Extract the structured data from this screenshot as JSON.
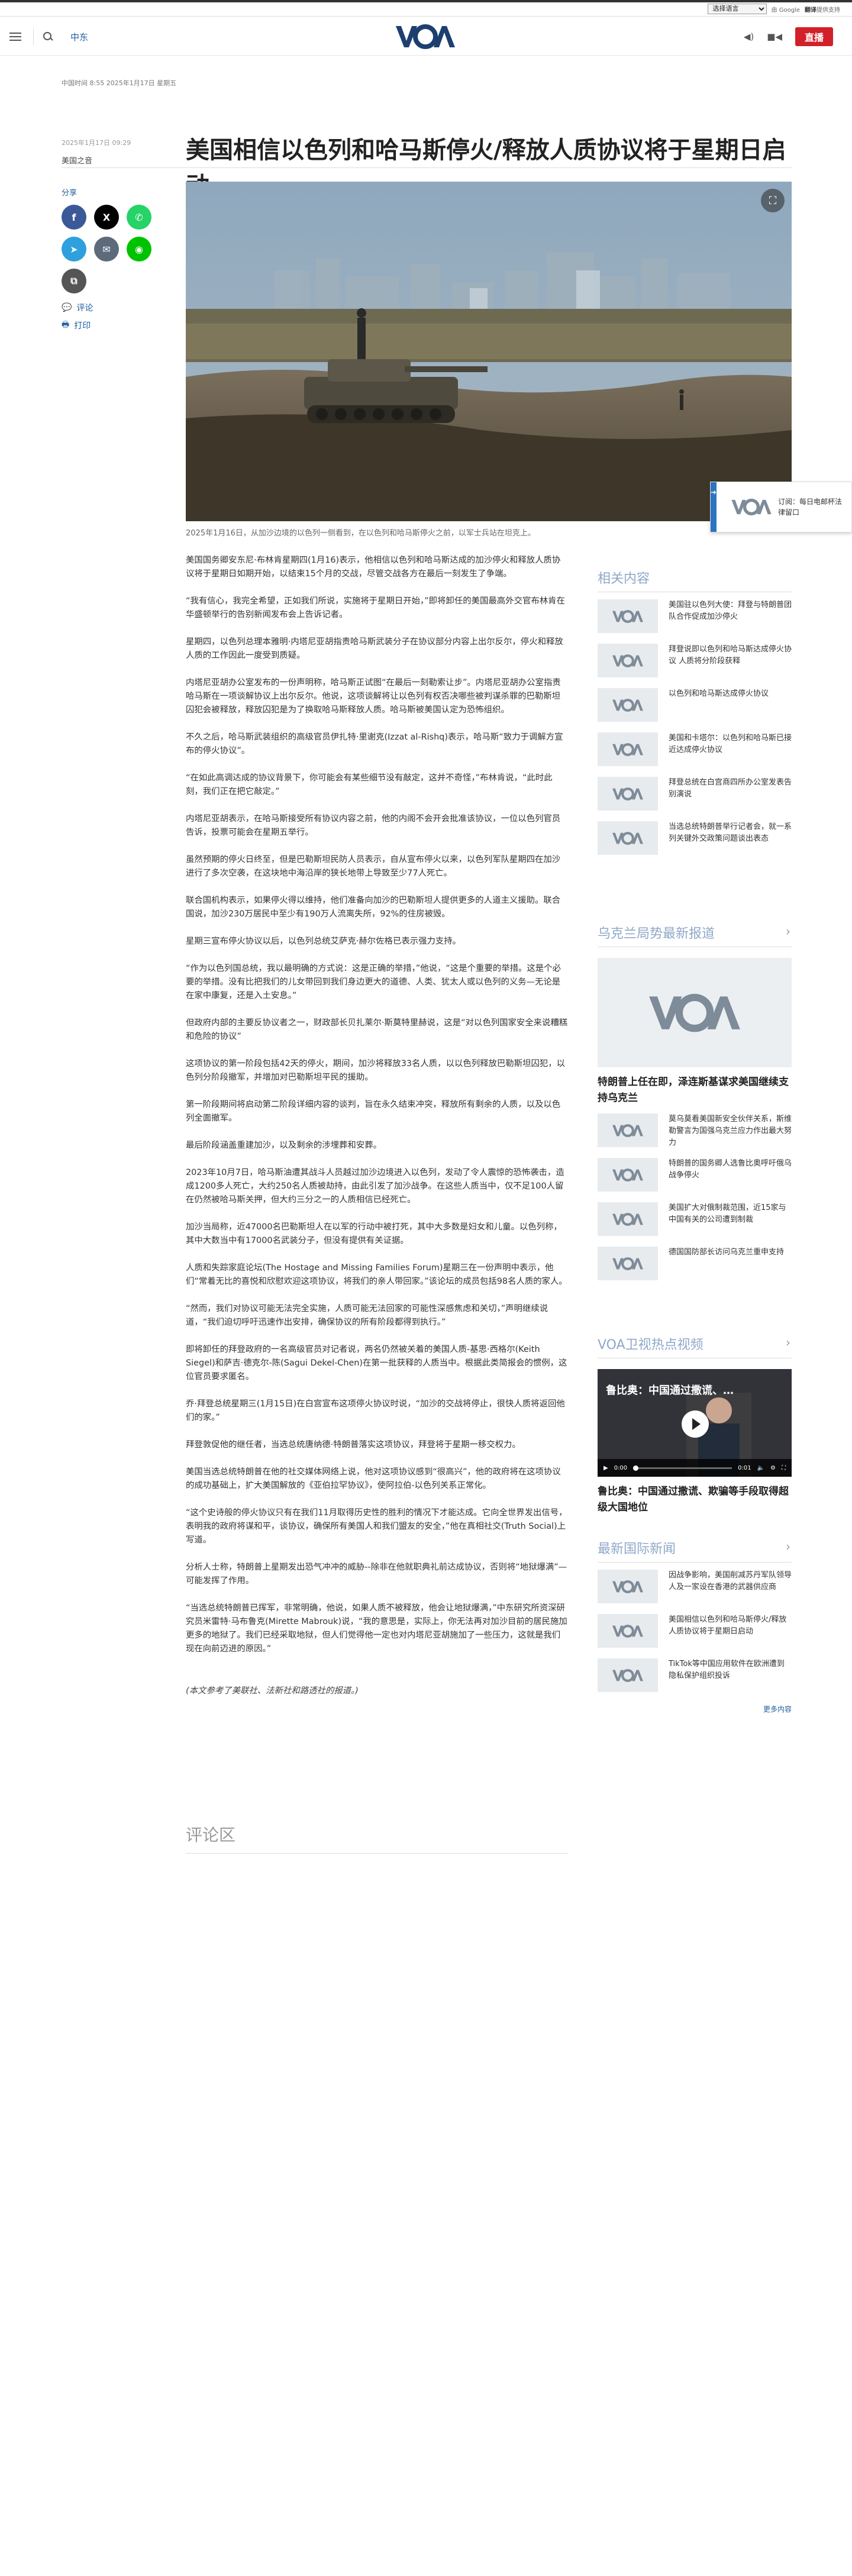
{
  "translate_bar": {
    "select_label": "选择语言",
    "powered_by": "由 Google",
    "translate_label": "翻译",
    "power_suffix": "提供支持"
  },
  "header": {
    "section": "中东",
    "logo_text": "VOA",
    "live_label": "直播"
  },
  "article": {
    "published": "中国时间 8:55 2025年1月17日 星期五",
    "updated": "2025年1月17日 09:29",
    "author": "美国之音",
    "title": "美国相信以色列和哈马斯停火/释放人质协议将于星期日启动",
    "caption": "2025年1月16日，从加沙边境的以色列一侧看到，在以色列和哈马斯停火之前，以军士兵站在坦克上。",
    "paragraphs": [
      "美国国务卿安东尼·布林肯星期四(1月16)表示，他相信以色列和哈马斯达成的加沙停火和释放人质协议将于星期日如期开始，以结束15个月的交战，尽管交战各方在最后一刻发生了争端。",
      "“我有信心，我完全希望，正如我们所说，实施将于星期日开始，”即将卸任的美国最高外交官布林肯在华盛顿举行的告别新闻发布会上告诉记者。",
      "星期四，以色列总理本雅明·内塔尼亚胡指责哈马斯武装分子在协议部分内容上出尔反尔，停火和释放人质的工作因此一度受到质疑。",
      "内塔尼亚胡办公室发布的一份声明称，哈马斯正试图“在最后一刻勒索让步”。内塔尼亚胡办公室指责哈马斯在一项谈解协议上出尔反尔。他说，这项谈解将让以色列有权否决哪些被判谋杀罪的巴勒斯坦囚犯会被释放，释放囚犯是为了换取哈马斯释放人质。哈马斯被美国认定为恐怖组织。",
      "不久之后，哈马斯武装组织的高级官员伊扎特·里谢克(Izzat al-Rishq)表示，哈马斯“致力于调解方宣布的停火协议”。",
      "“在如此高调达成的协议背景下，你可能会有某些细节没有敲定，这并不奇怪，”布林肯说，“此时此刻，我们正在把它敲定。”",
      "内塔尼亚胡表示，在哈马斯接受所有协议内容之前，他的内阁不会开会批准该协议，一位以色列官员告诉，投票可能会在星期五举行。",
      "虽然预期的停火日终至，但是巴勒斯坦民防人员表示，自从宣布停火以来，以色列军队星期四在加沙进行了多次空袭，在这块地中海沿岸的狭长地带上导致至少77人死亡。",
      "联合国机构表示，如果停火得以维持，他们准备向加沙的巴勒斯坦人提供更多的人道主义援助。联合国说，加沙230万居民中至少有190万人流离失所，92%的住房被毁。",
      "星期三宣布停火协议以后，以色列总统艾萨克·赫尔佐格已表示强力支持。",
      "“作为以色列国总统，我以最明确的方式说：这是正确的举措，”他说，“这是个重要的举措。这是个必要的举措。没有比把我们的儿女带回到我们身边更大的道德、人类、犹太人或以色列的义务—无论是在家中康复，还是入土安息。”",
      "但政府内部的主要反协议者之一，财政部长贝扎莱尔·斯莫特里赫说，这是“对以色列国家安全来说糟糕和危险的协议”",
      "这项协议的第一阶段包括42天的停火，期间，加沙将释放33名人质，以以色列释放巴勒斯坦囚犯，以色列分阶段撤军，并增加对巴勒斯坦平民的援助。",
      "第一阶段期间将启动第二阶段详细内容的谈判，旨在永久结束冲突，释放所有剩余的人质，以及以色列全面撤军。",
      "最后阶段涵盖重建加沙，以及剩余的涉埋葬和安葬。",
      "2023年10月7日，哈马斯油遭其战斗人员越过加沙边境进入以色列，发动了令人震惊的恐怖袭击，造成1200多人死亡，大约250名人质被劫持，由此引发了加沙战争。在这些人质当中，仅不足100人留在仍然被哈马斯关押，但大约三分之一的人质相信已经死亡。",
      "加沙当局称，近47000名巴勒斯坦人在以军的行动中被打死，其中大多数是妇女和儿童。以色列称，其中大数当中有17000名武装分子，但没有提供有关证据。",
      "人质和失踪家庭论坛(The Hostage and Missing Families Forum)星期三在一份声明中表示，他们“常着无比的喜悦和欣慰欢迎这项协议，将我们的亲人带回家。”该论坛的成员包括98名人质的家人。",
      "“然而，我们对协议可能无法完全实施，人质可能无法回家的可能性深感焦虑和关切，”声明继续说道，“我们迫切呼吁迅速作出安排，确保协议的所有阶段都得到执行。”",
      "即将卸任的拜登政府的一名高级官员对记者说，两名仍然被关着的美国人质-基思·西格尔(Keith Siegel)和萨吉·德克尔-陈(Sagui Dekel-Chen)在第一批获释的人质当中。根据此类简报会的惯例，这位官员要求匿名。",
      "乔·拜登总统星期三(1月15日)在白宫宣布这项停火协议时说，“加沙的交战将停止，很快人质将返回他们的家。”",
      "拜登敦促他的继任者，当选总统唐纳德·特朗普落实这项协议，拜登将于星期一移交权力。",
      "美国当选总统特朗普在他的社交媒体网络上说，他对这项协议感到“很高兴”，他的政府将在这项协议的成功基础上，扩大美国解放的《亚伯拉罕协议》，使阿拉伯-以色列关系正常化。",
      "“这个史诗般的停火协议只有在我们11月取得历史性的胜利的情况下才能达成。它向全世界发出信号，表明我的政府将谋和平，谈协议，确保所有美国人和我们盟友的安全，”他在真相社交(Truth Social)上写道。",
      "分析人士称，特朗普上星期发出恐气冲冲的威胁--除非在他就职典礼前达成协议，否则将“地狱爆满”—可能发挥了作用。",
      "“当选总统特朗普已挥军，非常明确，他说，如果人质不被释放，他会让地狱爆满，”中东研究所资深研究员米雷特·马布鲁克(Mirette Mabrouk)说，“我的意思是，实际上，你无法再对加沙目前的居民施加更多的地狱了。我们已经采取地狱，但人们觉得他一定也对内塔尼亚胡施加了一些压力，这就是我们现在向前迈进的原因。”"
    ],
    "note": "(本文参考了美联社、法新社和路透社的报道。)",
    "comments_heading": "评论区"
  },
  "share": {
    "label": "分享",
    "comment_label": "评论",
    "print_label": "打印"
  },
  "promo": {
    "text": "订阅：每日电邮杯法律留口"
  },
  "sidebar": {
    "related": {
      "heading": "相关内容",
      "items": [
        "美国驻以色列大使：拜登与特朗普团队合作促成加沙停火",
        "拜登说即以色列和哈马斯达成停火协议 人质将分阶段获释",
        "以色列和哈马斯达成停火协议",
        "美国和卡塔尔：以色列和哈马斯已接近达成停火协议",
        "拜登总统在白宫商四所办公室发表告别演说",
        "当选总统特朗普举行记者会，就一系列关键外交政策问题谈出表态"
      ]
    },
    "ukraine": {
      "heading": "乌克兰局势最新报道",
      "feature_title": "特朗普上任在即，泽连斯基谋求美国继续支持乌克兰",
      "items": [
        "莫乌莫看美国新安全伙伴关系，斯维勒警言为国强乌克兰应力作出最大努力",
        "特朗普的国务卿人选鲁比奥呼吁俄乌战争停火",
        "美国扩大对俄制裁范围，近15家与中国有关的公司遭到制裁",
        "德国国防部长访问乌克兰重申支持"
      ]
    },
    "video": {
      "heading": "VOA卫视热点视频",
      "player_title": "鲁比奥：中国通过撒谎、…",
      "time": "0:00",
      "duration": "0:01",
      "title": "鲁比奥：中国通过撒谎、欺骗等手段取得超级大国地位"
    },
    "news": {
      "heading": "最新国际新闻",
      "items": [
        "因战争影响，美国削减苏丹军队领导人及一家设在香港的武器供应商",
        "美国相信以色列和哈马斯停火/释放人质协议将于星期日启动",
        "TikTok等中国应用软件在欧洲遭到隐私保护组织投诉"
      ],
      "more": "更多内容"
    }
  },
  "colors": {
    "live": "#d12029",
    "link": "#1f5fa0",
    "sidebar_heading": "#8fa8c8"
  }
}
